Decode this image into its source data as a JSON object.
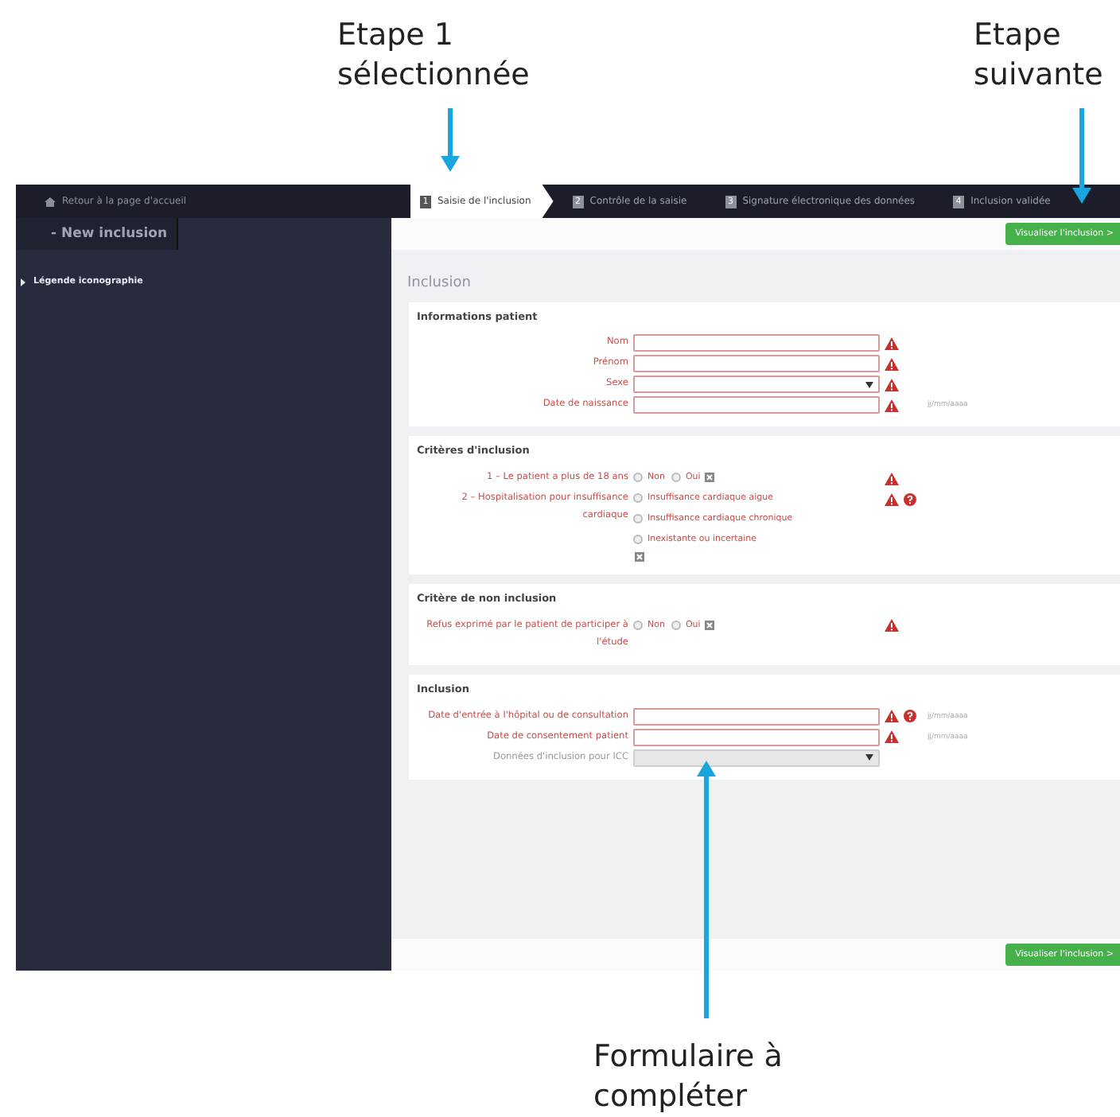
{
  "annotations": [
    {
      "kind": "down",
      "lines": [
        "Etape 1",
        "sélectionnée"
      ]
    },
    {
      "kind": "down",
      "lines": [
        "Etape",
        "suivante"
      ]
    },
    {
      "kind": "up",
      "lines": [
        "Formulaire à",
        "compléter"
      ]
    }
  ],
  "app": {
    "back_link": "Retour à la page d'accueil",
    "steps": [
      {
        "number": "1",
        "label": "Saisie de l'inclusion",
        "selected": true
      },
      {
        "number": "2",
        "label": "Contrôle de la saisie",
        "selected": false
      },
      {
        "number": "3",
        "label": "Signature électronique des données",
        "selected": false
      },
      {
        "number": "4",
        "label": "Inclusion validée",
        "selected": false
      }
    ],
    "sidebar": {
      "title": "- New inclusion",
      "items": [
        {
          "label": "Légende iconographie",
          "expanded": false
        }
      ]
    },
    "top_button": "Visualiser l'inclusion >",
    "page_title": "Inclusion",
    "sections": [
      {
        "title": "Informations patient",
        "fields": [
          {
            "kind": "text",
            "label": "Nom",
            "disabled": false,
            "warning": true,
            "help": false
          },
          {
            "kind": "text",
            "label": "Prénom",
            "disabled": false,
            "warning": true,
            "help": false
          },
          {
            "kind": "select",
            "label": "Sexe",
            "disabled": false,
            "warning": true,
            "help": false
          },
          {
            "kind": "text",
            "label": "Date de naissance",
            "disabled": false,
            "warning": true,
            "help": false,
            "hint": "jj/mm/aaaa"
          }
        ]
      },
      {
        "title": "Critères d'inclusion",
        "fields": [
          {
            "kind": "radio-inline",
            "label": "1 – Le patient a plus de 18 ans",
            "disabled": false,
            "warning": true,
            "help": false,
            "options": [
              {
                "label": "Non",
                "selected": false
              },
              {
                "label": "Oui",
                "selected": false
              }
            ]
          },
          {
            "kind": "radio-stacked",
            "label": "2 – Hospitalisation pour insuffisance cardiaque",
            "disabled": false,
            "warning": true,
            "help": true,
            "options": [
              {
                "label": "Insuffisance cardiaque aigue",
                "selected": false
              },
              {
                "label": "Insuffisance cardiaque chronique",
                "selected": false
              },
              {
                "label": "Inexistante ou incertaine",
                "selected": false
              }
            ]
          }
        ]
      },
      {
        "title": "Critère de non inclusion",
        "fields": [
          {
            "kind": "radio-inline",
            "label": "Refus exprimé par le patient de participer à l'étude",
            "disabled": false,
            "warning": true,
            "help": false,
            "options": [
              {
                "label": "Non",
                "selected": false
              },
              {
                "label": "Oui",
                "selected": false
              }
            ]
          }
        ]
      },
      {
        "title": "Inclusion",
        "fields": [
          {
            "kind": "text",
            "label": "Date d'entrée à l'hôpital ou de consultation",
            "disabled": false,
            "warning": true,
            "help": true,
            "hint": "jj/mm/aaaa"
          },
          {
            "kind": "text",
            "label": "Date de consentement patient",
            "disabled": false,
            "warning": true,
            "help": false,
            "hint": "jj/mm/aaaa"
          },
          {
            "kind": "select",
            "label": "Données d'inclusion pour ICC",
            "disabled": true,
            "warning": false,
            "help": false
          }
        ]
      }
    ],
    "bottom_button": "Visualiser l'inclusion >"
  }
}
